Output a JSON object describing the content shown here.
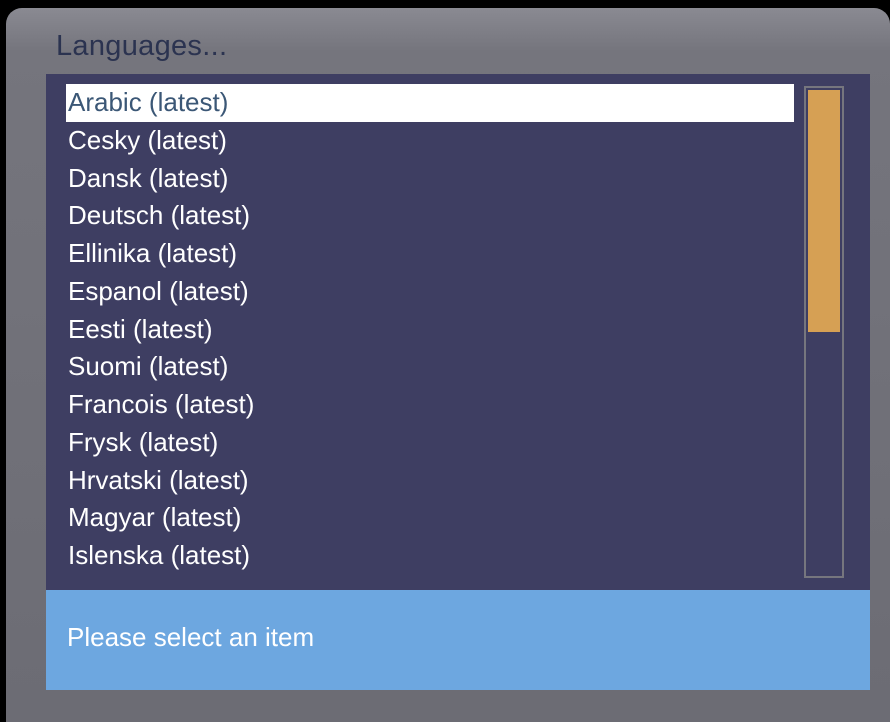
{
  "dialog": {
    "title": "Languages..."
  },
  "list": {
    "selected_index": 0,
    "items": [
      {
        "label": "Arabic (latest)"
      },
      {
        "label": "Cesky (latest)"
      },
      {
        "label": "Dansk (latest)"
      },
      {
        "label": "Deutsch (latest)"
      },
      {
        "label": "Ellinika (latest)"
      },
      {
        "label": "Espanol (latest)"
      },
      {
        "label": "Eesti (latest)"
      },
      {
        "label": "Suomi (latest)"
      },
      {
        "label": "Francois (latest)"
      },
      {
        "label": "Frysk (latest)"
      },
      {
        "label": "Hrvatski (latest)"
      },
      {
        "label": "Magyar (latest)"
      },
      {
        "label": "Islenska (latest)"
      }
    ]
  },
  "scrollbar": {
    "thumb_start_fraction": 0.0,
    "thumb_size_fraction": 0.5
  },
  "status": {
    "text": "Please select an item"
  },
  "colors": {
    "panel_background": "#3e3e62",
    "selection_background": "#ffffff",
    "selection_text": "#3b5776",
    "scroll_thumb": "#d6a054",
    "status_background": "#6da7e0"
  }
}
